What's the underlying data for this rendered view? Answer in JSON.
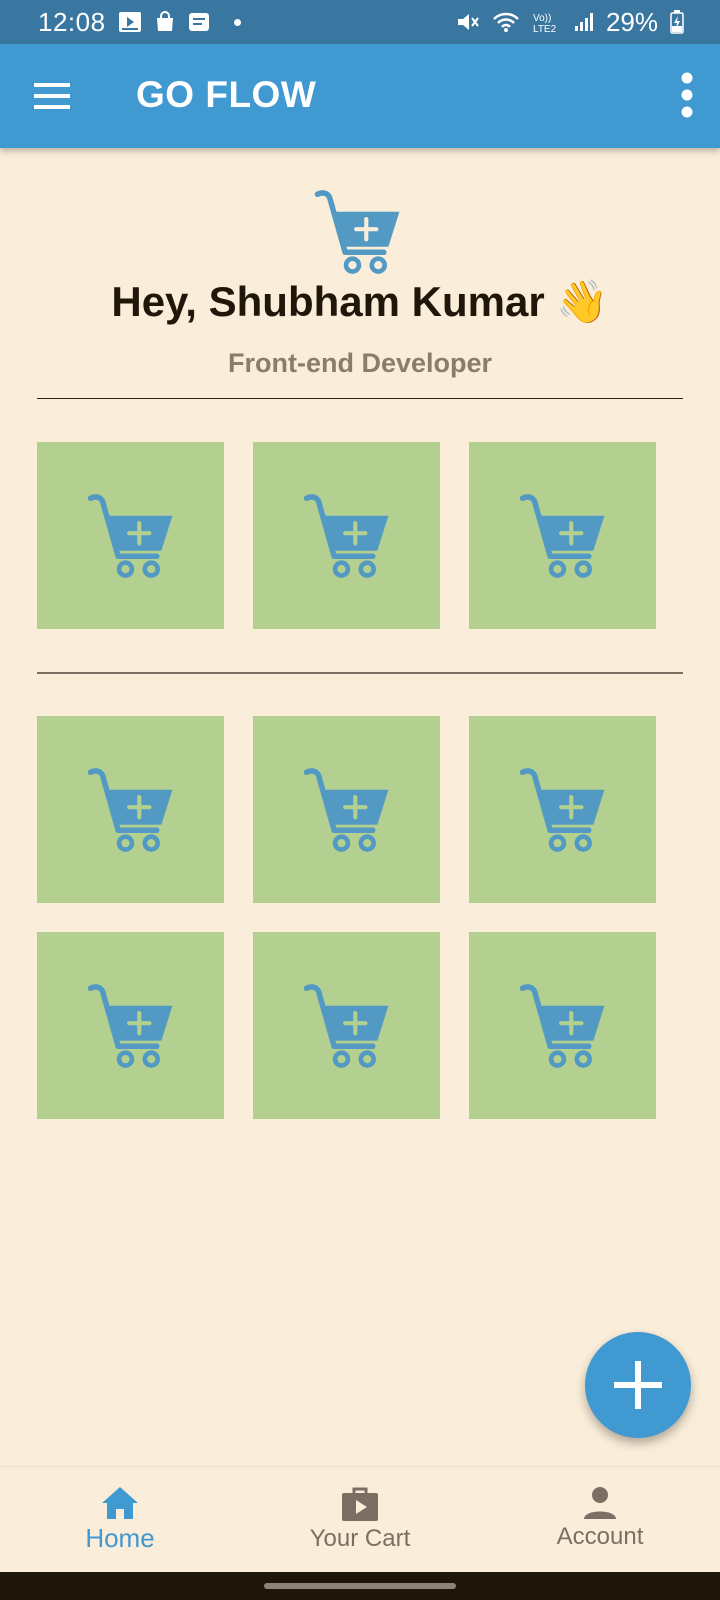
{
  "status_bar": {
    "time": "12:08",
    "battery": "29%",
    "icons": [
      "screen-record-icon",
      "shopping-bag-icon",
      "message-icon",
      "dot-icon",
      "mute-icon",
      "wifi-icon",
      "volte-icon",
      "signal-icon",
      "battery-charging-icon"
    ]
  },
  "app_bar": {
    "title": "GO FLOW",
    "menu_icon": "hamburger-menu-icon",
    "overflow_icon": "more-vert-icon"
  },
  "header": {
    "logo_icon": "add-to-cart-icon",
    "greeting": "Hey, Shubham Kumar 👋",
    "subtitle": "Front-end Developer"
  },
  "sections": [
    {
      "tiles": [
        "add-to-cart-icon",
        "add-to-cart-icon",
        "add-to-cart-icon"
      ]
    },
    {
      "tiles": [
        "add-to-cart-icon",
        "add-to-cart-icon",
        "add-to-cart-icon",
        "add-to-cart-icon",
        "add-to-cart-icon",
        "add-to-cart-icon"
      ]
    }
  ],
  "fab": {
    "icon": "plus-icon"
  },
  "bottom_nav": {
    "items": [
      {
        "label": "Home",
        "icon": "home-icon",
        "active": true
      },
      {
        "label": "Your Cart",
        "icon": "cart-bag-icon",
        "active": false
      },
      {
        "label": "Account",
        "icon": "person-icon",
        "active": false
      }
    ]
  },
  "colors": {
    "app_bar": "#4199D2",
    "status_bar": "#3A77A0",
    "background": "#FAEDD9",
    "tile": "#B3D090",
    "cart_icon": "#5299C4",
    "active_nav": "#4199D2",
    "inactive_nav": "#7A6F62"
  }
}
